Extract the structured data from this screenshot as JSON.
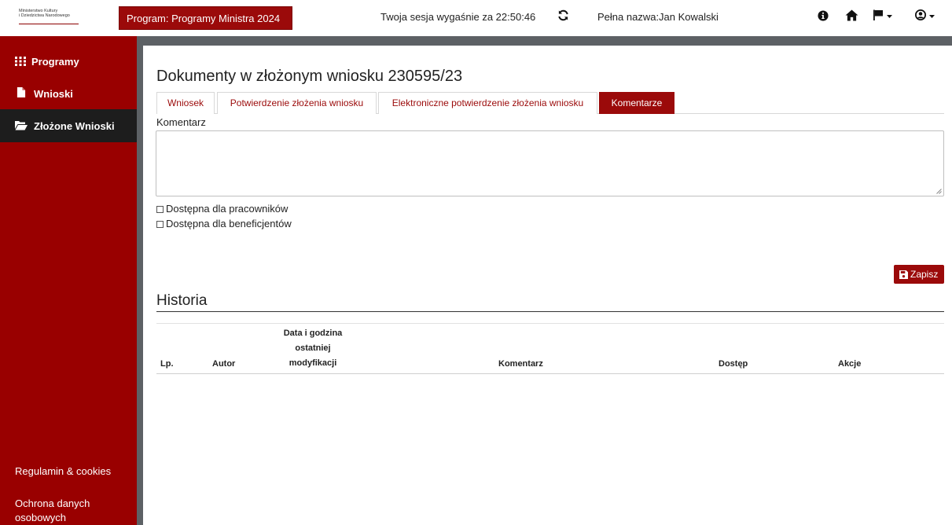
{
  "header": {
    "logo_line1": "Ministerstwo Kultury",
    "logo_line2": "i Dziedzictwa Narodowego",
    "program_button": "Program: Programy Ministra 2024",
    "session_text": "Twoja sesja wygaśnie za 22:50:46",
    "full_name": "Pełna nazwa:Jan Kowalski"
  },
  "sidebar": {
    "items": [
      {
        "label": "Programy",
        "icon": "grid-icon"
      },
      {
        "label": "Wnioski",
        "icon": "file-icon"
      },
      {
        "label": "Złożone Wnioski",
        "icon": "folder-open-icon"
      }
    ],
    "footer_links": [
      {
        "label": "Regulamin & cookies"
      },
      {
        "label": "Ochrona danych osobowych"
      }
    ]
  },
  "main": {
    "title": "Dokumenty w złożonym wniosku 230595/23",
    "tabs": [
      {
        "label": "Wniosek"
      },
      {
        "label": "Potwierdzenie złożenia wniosku"
      },
      {
        "label": "Elektroniczne potwierdzenie złożenia wniosku"
      },
      {
        "label": "Komentarze"
      }
    ],
    "active_tab": "Komentarze",
    "comment_label": "Komentarz",
    "comment_value": "",
    "checkbox_employees": "Dostępna dla pracowników",
    "checkbox_beneficiaries": "Dostępna dla beneficjentów",
    "save_button": "Zapisz",
    "history_title": "Historia",
    "table_headers": {
      "lp": "Lp.",
      "author": "Autor",
      "date": "Data i godzina ostatniej modyfikacji",
      "comment": "Komentarz",
      "access": "Dostęp",
      "actions": "Akcje"
    },
    "table_rows": []
  },
  "colors": {
    "brand_red": "#9b0a0a",
    "sidebar_red": "#990000",
    "sidebar_active": "#1d1d1d",
    "separator_gray": "#5d6165"
  }
}
